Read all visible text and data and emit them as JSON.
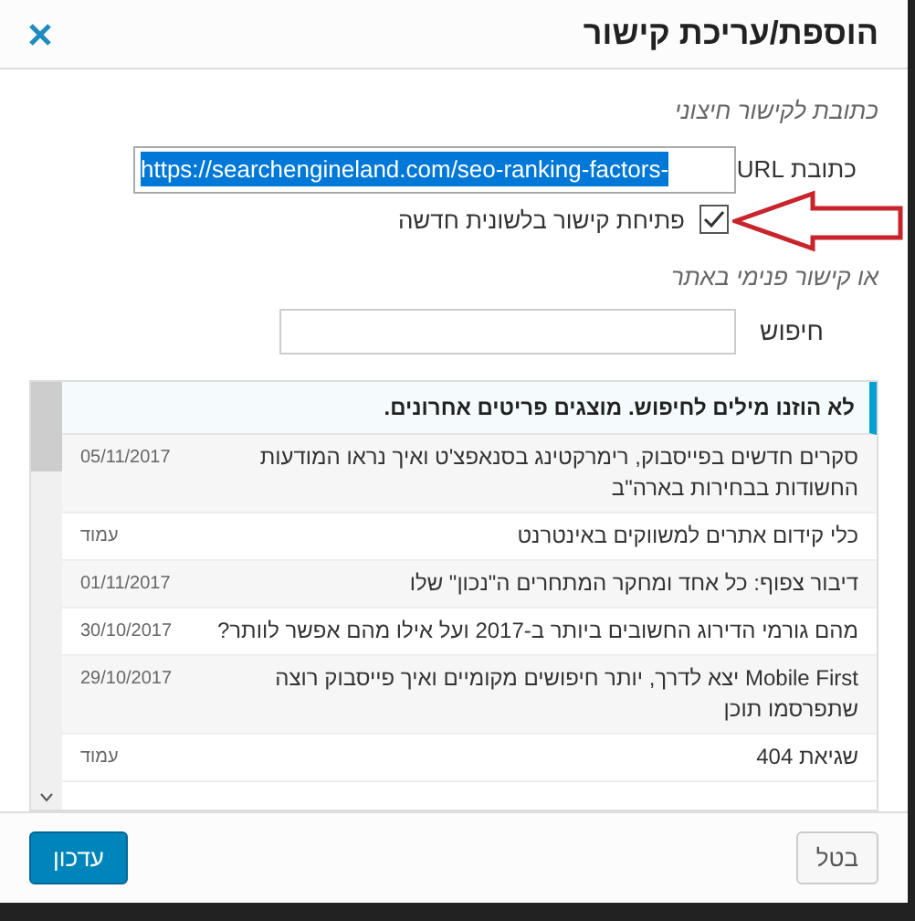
{
  "dialog": {
    "title": "הוספת/עריכת קישור"
  },
  "external": {
    "heading": "כתובת לקישור חיצוני",
    "url_label": "כתובת URL",
    "url_value": "https://searchengineland.com/seo-ranking-factors-",
    "new_tab_label": "פתיחת קישור בלשונית חדשה",
    "new_tab_checked": true
  },
  "internal": {
    "heading": "או קישור פנימי באתר",
    "search_label": "חיפוש"
  },
  "results": {
    "notice": "לא הוזנו מילים לחיפוש. מוצגים פריטים אחרונים.",
    "rows": [
      {
        "title": "סקרים חדשים בפייסבוק, רימרקטינג בסנאפצ'ט ואיך נראו המודעות החשודות בבחירות בארה\"ב",
        "info": "05/11/2017"
      },
      {
        "title": "כלי קידום אתרים למשווקים באינטרנט",
        "info": "עמוד"
      },
      {
        "title": "דיבור צפוף: כל אחד ומחקר המתחרים ה\"נכון\" שלו",
        "info": "01/11/2017"
      },
      {
        "title": "מהם גורמי הדירוג החשובים ביותר ב-2017 ועל אילו מהם אפשר לוותר?",
        "info": "30/10/2017"
      },
      {
        "title": "Mobile First יצא לדרך, יותר חיפושים מקומיים ואיך פייסבוק רוצה שתפרסמו תוכן",
        "info": "29/10/2017"
      },
      {
        "title": "שגיאת 404",
        "info": "עמוד"
      }
    ]
  },
  "buttons": {
    "cancel": "בטל",
    "update": "עדכון"
  }
}
